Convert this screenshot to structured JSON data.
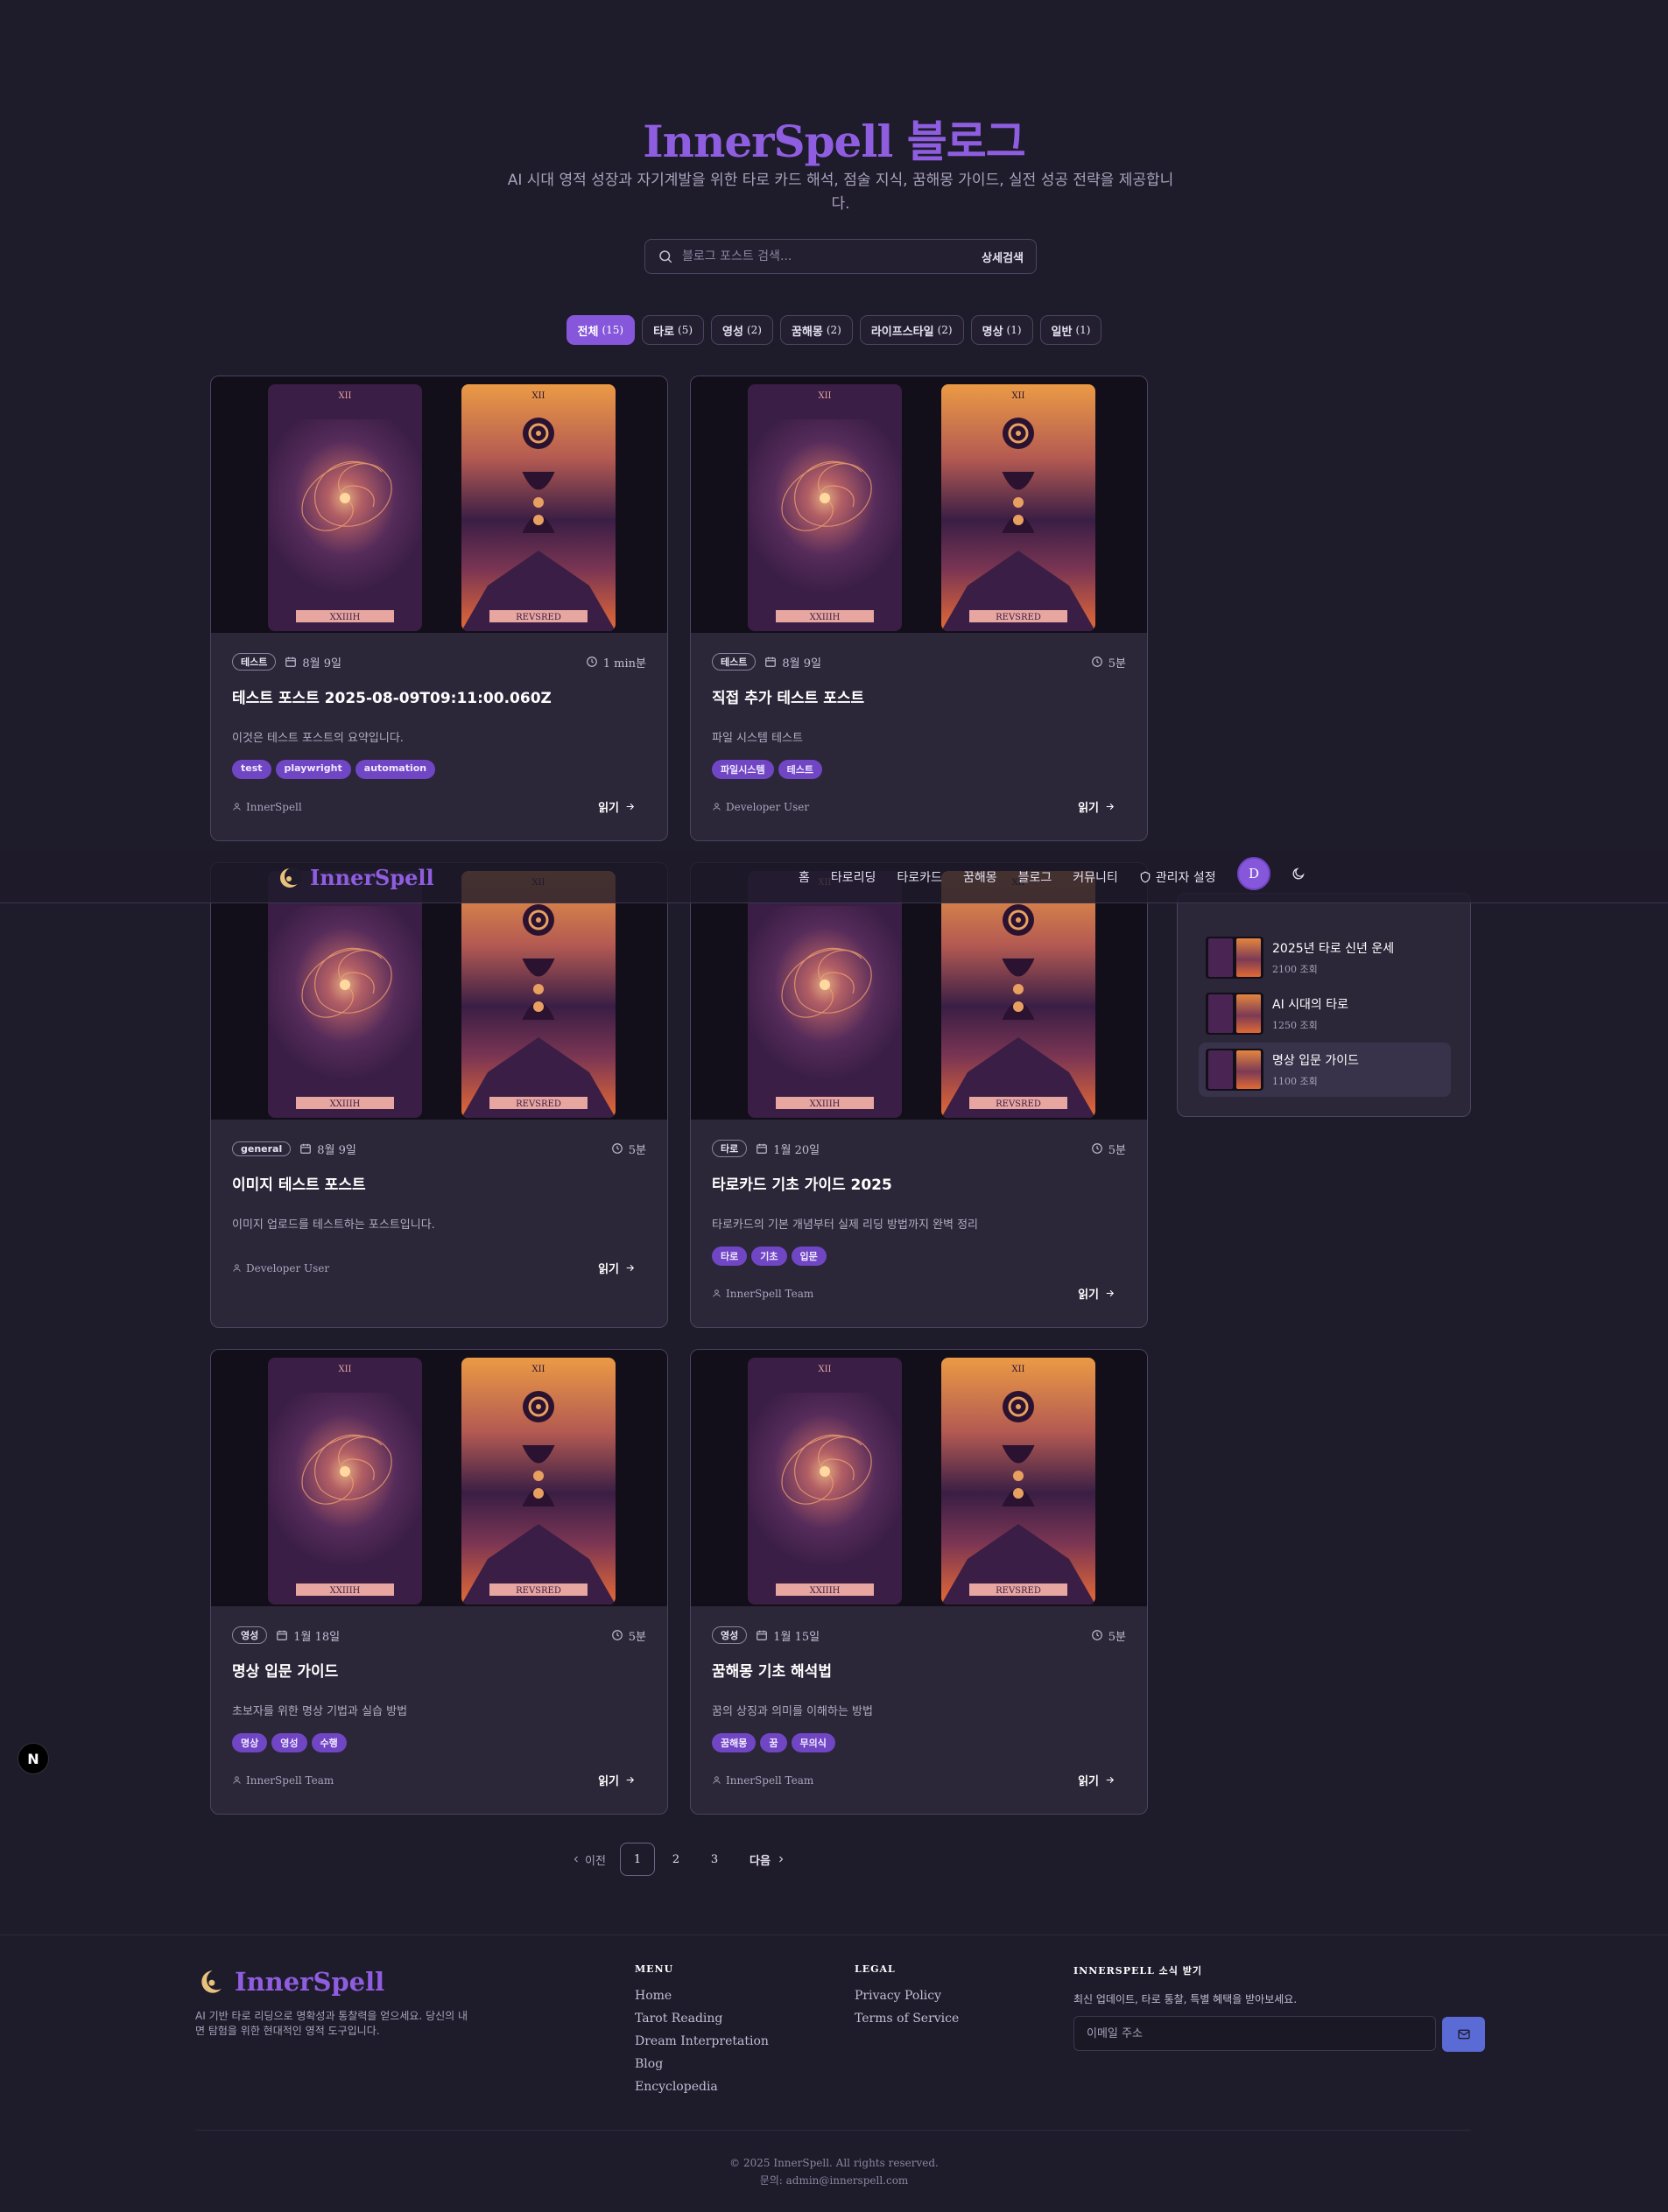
{
  "hero": {
    "title": "InnerSpell 블로그",
    "subtitle": "AI 시대 영적 성장과 자기계발을 위한 타로 카드 해석, 점술 지식, 꿈해몽 가이드, 실전 성공 전략을 제공합니다."
  },
  "search": {
    "placeholder": "블로그 포스트 검색...",
    "advanced_label": "상세검색"
  },
  "filters": [
    {
      "label": "전체",
      "count": "(15)",
      "active": true
    },
    {
      "label": "타로",
      "count": "(5)"
    },
    {
      "label": "영성",
      "count": "(2)"
    },
    {
      "label": "꿈해몽",
      "count": "(2)"
    },
    {
      "label": "라이프스타일",
      "count": "(2)"
    },
    {
      "label": "명상",
      "count": "(1)"
    },
    {
      "label": "일반",
      "count": "(1)"
    }
  ],
  "tarot_labels": {
    "left_numeral": "XII",
    "left_caption": "XXIIIH",
    "right_numeral": "XII",
    "right_caption": "REVSRED"
  },
  "read_label": "읽기",
  "posts": [
    {
      "category": "테스트",
      "date": "8월 9일",
      "read_time": "1 min분",
      "title": "테스트 포스트 2025-08-09T09:11:00.060Z",
      "excerpt": "이것은 테스트 포스트의 요약입니다.",
      "tags": [
        "test",
        "playwright",
        "automation"
      ],
      "author": "InnerSpell"
    },
    {
      "category": "테스트",
      "date": "8월 9일",
      "read_time": "5분",
      "title": "직접 추가 테스트 포스트",
      "excerpt": "파일 시스템 테스트",
      "tags": [
        "파일시스템",
        "테스트"
      ],
      "author": "Developer User"
    },
    {
      "category": "general",
      "date": "8월 9일",
      "read_time": "5분",
      "title": "이미지 테스트 포스트",
      "excerpt": "이미지 업로드를 테스트하는 포스트입니다.",
      "tags": [],
      "author": "Developer User"
    },
    {
      "category": "타로",
      "date": "1월 20일",
      "read_time": "5분",
      "title": "타로카드 기초 가이드 2025",
      "excerpt": "타로카드의 기본 개념부터 실제 리딩 방법까지 완벽 정리",
      "tags": [
        "타로",
        "기초",
        "입문"
      ],
      "author": "InnerSpell Team"
    },
    {
      "category": "영성",
      "date": "1월 18일",
      "read_time": "5분",
      "title": "명상 입문 가이드",
      "excerpt": "초보자를 위한 명상 기법과 실습 방법",
      "tags": [
        "명상",
        "영성",
        "수행"
      ],
      "author": "InnerSpell Team"
    },
    {
      "category": "영성",
      "date": "1월 15일",
      "read_time": "5분",
      "title": "꿈해몽 기초 해석법",
      "excerpt": "꿈의 상징과 의미를 이해하는 방법",
      "tags": [
        "꿈해몽",
        "꿈",
        "무의식"
      ],
      "author": "InnerSpell Team"
    }
  ],
  "nav": {
    "brand": "InnerSpell",
    "links": [
      "홈",
      "타로리딩",
      "타로카드",
      "꿈해몽",
      "블로그",
      "커뮤니티"
    ],
    "admin": "관리자 설정",
    "avatar_initial": "D"
  },
  "popular": [
    {
      "title": "2025년 타로 신년 운세",
      "views": "2100 조회"
    },
    {
      "title": "AI 시대의 타로",
      "views": "1250 조회"
    },
    {
      "title": "명상 입문 가이드",
      "views": "1100 조회"
    }
  ],
  "pagination": {
    "prev": "이전",
    "pages": [
      "1",
      "2",
      "3"
    ],
    "current": "1",
    "next": "다음"
  },
  "nextjs_badge": "N",
  "footer": {
    "brand": "InnerSpell",
    "description": "AI 기반 타로 리딩으로 명확성과 통찰력을 얻으세요. 당신의 내면 탐험을 위한 현대적인 영적 도구입니다.",
    "menu_title": "MENU",
    "menu": [
      "Home",
      "Tarot Reading",
      "Dream Interpretation",
      "Blog",
      "Encyclopedia"
    ],
    "legal_title": "LEGAL",
    "legal": [
      "Privacy Policy",
      "Terms of Service"
    ],
    "newsletter_title": "INNERSPELL 소식 받기",
    "newsletter_text": "최신 업데이트, 타로 통찰, 특별 혜택을 받아보세요.",
    "email_placeholder": "이메일 주소",
    "copyright": "© 2025 InnerSpell. All rights reserved.",
    "contact": "문의: admin@innerspell.com"
  },
  "colors": {
    "accent": "#8656db",
    "brand_text": "#8f5ee0",
    "tag_bg": "#7046c4",
    "bg": "#1e1b2b",
    "card_bg": "#2b2638"
  }
}
